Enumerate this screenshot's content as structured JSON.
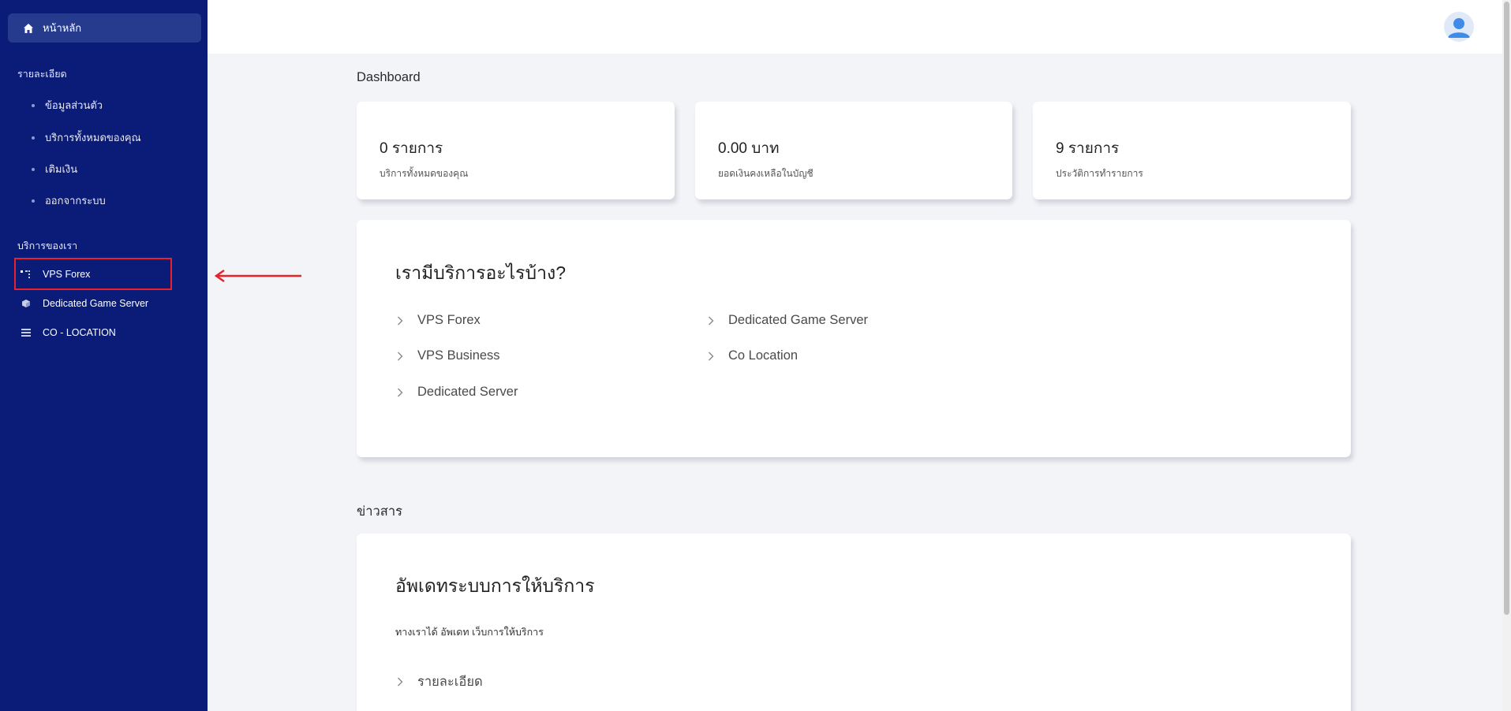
{
  "sidebar": {
    "home_label": "หน้าหลัก",
    "details_heading": "รายละเอียด",
    "details_items": [
      "ข้อมูลส่วนตัว",
      "บริการทั้งหมดของคุณ",
      "เติมเงิน",
      "ออกจากระบบ"
    ],
    "services_heading": "บริการของเรา",
    "services_items": [
      {
        "label": "VPS Forex",
        "icon": "list-icon"
      },
      {
        "label": "Dedicated Game Server",
        "icon": "cube-icon"
      },
      {
        "label": "CO - LOCATION",
        "icon": "server-icon"
      }
    ]
  },
  "dashboard": {
    "title": "Dashboard",
    "stats": [
      {
        "value": "0 รายการ",
        "label": "บริการทั้งหมดของคุณ"
      },
      {
        "value": "0.00 บาท",
        "label": "ยอดเงินคงเหลือในบัญชี"
      },
      {
        "value": "9 รายการ",
        "label": "ประวัติการทำรายการ"
      }
    ]
  },
  "services_card": {
    "title": "เรามีบริการอะไรบ้าง?",
    "left_links": [
      "VPS Forex",
      "VPS Business",
      "Dedicated Server"
    ],
    "right_links": [
      "Dedicated Game Server",
      "Co Location"
    ]
  },
  "news": {
    "title": "ข่าวสาร",
    "card_title": "อัพเดทระบบการให้บริการ",
    "description": "ทางเราได้ อัพเดท เว็บการให้บริการ",
    "link": "รายละเอียด"
  },
  "colors": {
    "sidebar_bg": "#0a1c78",
    "sidebar_active": "#263a8e",
    "annotation_red": "#e8222a"
  }
}
